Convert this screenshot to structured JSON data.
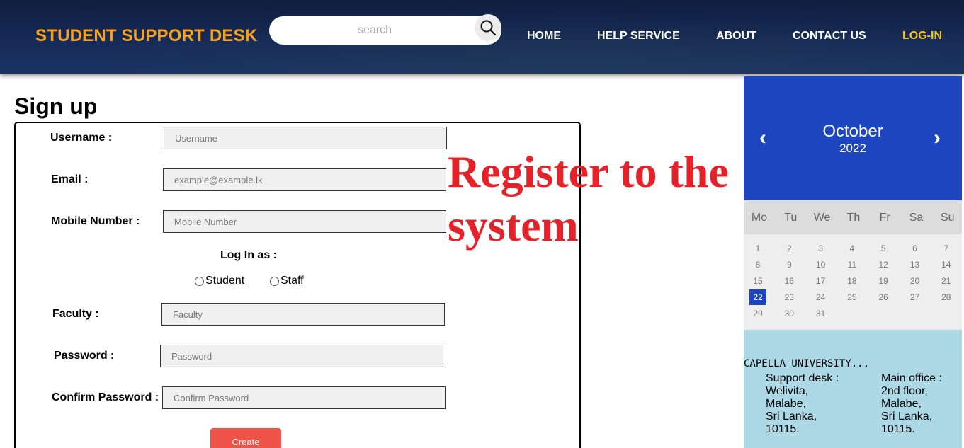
{
  "header": {
    "brand": "STUDENT SUPPORT DESK",
    "search_placeholder": "search",
    "nav": [
      "HOME",
      "HELP SERVICE",
      "ABOUT",
      "CONTACT US",
      "LOG-IN"
    ],
    "colors": {
      "brand": "#f6a21f",
      "login": "#f6c518"
    }
  },
  "signup": {
    "title": "Sign up",
    "fields": [
      {
        "label": "Username :",
        "placeholder": "Username"
      },
      {
        "label": "Email :",
        "placeholder": "example@example.lk"
      },
      {
        "label": "Mobile Number :",
        "placeholder": "Mobile Number"
      },
      {
        "label": "Faculty :",
        "placeholder": "Faculty"
      },
      {
        "label": "Password :",
        "placeholder": "Password"
      },
      {
        "label": "Confirm Password :",
        "placeholder": "Confirm Password"
      }
    ],
    "login_as_label": "Log In as :",
    "roles": [
      "Student",
      "Staff"
    ],
    "create_label": "Create"
  },
  "banner": {
    "line1": "Register to the",
    "line2": "system"
  },
  "calendar": {
    "month": "October",
    "year": "2022",
    "prev_icon": "‹",
    "next_icon": "›",
    "weekdays": [
      "Mo",
      "Tu",
      "We",
      "Th",
      "Fr",
      "Sa",
      "Su"
    ],
    "days": [
      "1",
      "2",
      "3",
      "4",
      "5",
      "6",
      "7",
      "8",
      "9",
      "10",
      "11",
      "12",
      "13",
      "14",
      "15",
      "16",
      "17",
      "18",
      "19",
      "20",
      "21",
      "22",
      "23",
      "24",
      "25",
      "26",
      "27",
      "28",
      "29",
      "30",
      "31"
    ],
    "today": "22"
  },
  "info": {
    "university": "CAPELLA UNIVERSITY...",
    "support": [
      "Support desk :",
      "Welivita,",
      "Malabe,",
      "Sri Lanka,",
      "10115."
    ],
    "main_office": [
      "Main office :",
      "2nd floor,",
      "Malabe,",
      "Sri Lanka,",
      "10115."
    ]
  }
}
